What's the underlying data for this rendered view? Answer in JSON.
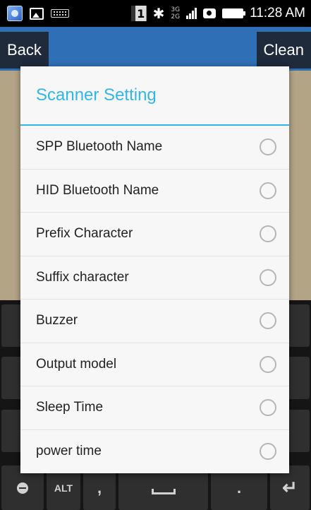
{
  "status_bar": {
    "sim_label": "1",
    "network_top": "3G",
    "network_bottom": "2G",
    "time": "11:28 AM"
  },
  "action_bar": {
    "back_label": "Back",
    "clean_label": "Clean"
  },
  "dialog": {
    "title": "Scanner Setting",
    "options": [
      {
        "label": "SPP Bluetooth Name"
      },
      {
        "label": "HID Bluetooth Name"
      },
      {
        "label": "Prefix Character"
      },
      {
        "label": "Suffix character"
      },
      {
        "label": "Buzzer"
      },
      {
        "label": "Output model"
      },
      {
        "label": "Sleep Time"
      },
      {
        "label": "power time"
      }
    ]
  },
  "keyboard": {
    "alt_label": "ALT",
    "comma_label": ",",
    "dot_label": ".",
    "enter_label": "↵"
  },
  "colors": {
    "accent": "#33b5e5",
    "action_bar": "#2f6fb6"
  }
}
